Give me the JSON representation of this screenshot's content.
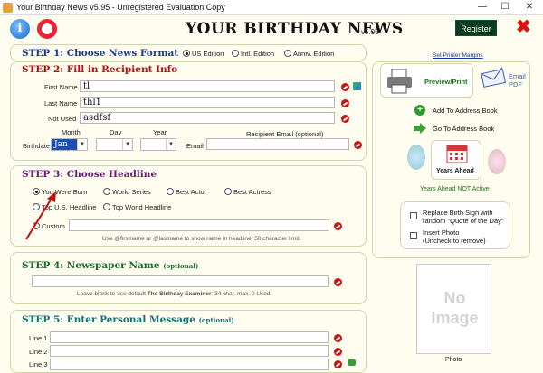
{
  "window": {
    "title": "Your Birthday News v5.95 - Unregistered Evaluation Copy",
    "min": "—",
    "max": "☐",
    "close": "✕"
  },
  "header": {
    "brand": "YOUR BIRTHDAY NEWS",
    "version": "v5.95",
    "register_label": "Register",
    "info_glyph": "i"
  },
  "step1": {
    "title": "STEP 1: Choose News Format",
    "options": [
      "US Edition",
      "Intl. Edition",
      "Anniv. Edition"
    ],
    "selected": "US Edition"
  },
  "step2": {
    "title": "STEP 2: Fill in Recipient Info",
    "first_name_label": "First Name",
    "first_name_value": "tl",
    "last_name_label": "Last Name",
    "last_name_value": "thl1",
    "not_used_label": "Not Used",
    "not_used_value": "asdfsf",
    "month_label": "Month",
    "day_label": "Day",
    "year_label": "Year",
    "birthdate_label": "Birthdate",
    "month_value": "Jan",
    "recipient_email_label": "Recipient Email (optional)",
    "email_label": "Email"
  },
  "step3": {
    "title": "STEP 3: Choose Headline",
    "options": [
      "You Were Born",
      "World Series",
      "Best Actor",
      "Best Actress",
      "Top U.S. Headline",
      "Top World Headline",
      "Custom"
    ],
    "selected": "You Were Born",
    "hint": "Use @firstname or @lastname to show name in headline. 50 character limit."
  },
  "step4": {
    "title": "STEP 4: Newspaper Name",
    "optional": "(optional)",
    "hint_pre": "Leave blank to use default",
    "hint_bold": "The Birthday Examiner",
    "hint_post": ". 34 char. max. 0 Used."
  },
  "step5": {
    "title": "STEP 5: Enter Personal Message",
    "optional": "(optional)",
    "lines": [
      "Line 1",
      "Line 2",
      "Line 3"
    ]
  },
  "sidebar": {
    "printer_margins": "Set Printer Margins",
    "preview_print": "Preview/Print",
    "email_pdf_line1": "Email",
    "email_pdf_line2": "PDF",
    "add_address_book": "Add To Address Book",
    "go_address_book": "Go To Address Book",
    "years_ahead": "Years Ahead",
    "years_ahead_status": "Years Ahead NOT Active",
    "replace_sign_line1": "Replace Birth Sign with",
    "replace_sign_line2": "random \"Quote of the Day\"",
    "insert_photo_line1": "Insert Photo",
    "insert_photo_line2": "(Uncheck to remove)",
    "no_image_line1": "No",
    "no_image_line2": "Image",
    "photo_label": "Photo"
  },
  "colors": {
    "register_bg": "#0f3a22",
    "step1": "#1b3a8a",
    "step2": "#b01010",
    "step3": "#6b1a7a",
    "step4": "#1a6b2a",
    "step5": "#147070",
    "cancel_icon": "#cc1111"
  }
}
